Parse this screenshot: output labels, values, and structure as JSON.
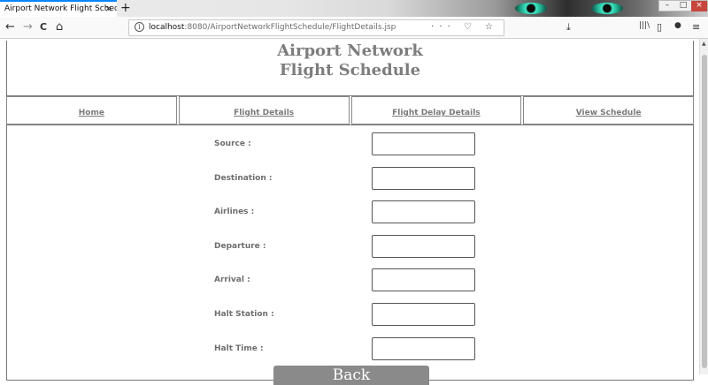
{
  "browser": {
    "tab_title": "Airport Network Flight Schedule",
    "tab_close": "×",
    "new_tab": "+",
    "nav": {
      "back": "←",
      "forward": "→",
      "reload": "C",
      "home": "⌂"
    },
    "url_host": "localhost",
    "url_rest": ":8080/AirportNetworkFlightSchedule/FlightDetails.jsp",
    "url_actions": "··· ♡ ☆",
    "toolbar_right": {
      "download": "⤓",
      "library": "|||\\",
      "sidebar": "▯",
      "account": "●",
      "menu": "≡"
    },
    "window_controls": {
      "minimize": "–",
      "maximize": "□",
      "close": "×"
    }
  },
  "page": {
    "title_line1": "Airport Network",
    "title_line2": "Flight Schedule",
    "menu": [
      {
        "label": "Home"
      },
      {
        "label": "Flight Details"
      },
      {
        "label": "Flight Delay Details"
      },
      {
        "label": "View Schedule"
      }
    ],
    "form": {
      "fields": [
        {
          "label": "Source :",
          "value": ""
        },
        {
          "label": "Destination :",
          "value": ""
        },
        {
          "label": "Airlines :",
          "value": ""
        },
        {
          "label": "Departure :",
          "value": ""
        },
        {
          "label": "Arrival :",
          "value": ""
        },
        {
          "label": "Halt Station :",
          "value": ""
        },
        {
          "label": "Halt Time :",
          "value": ""
        }
      ],
      "back_button": "Back"
    }
  }
}
